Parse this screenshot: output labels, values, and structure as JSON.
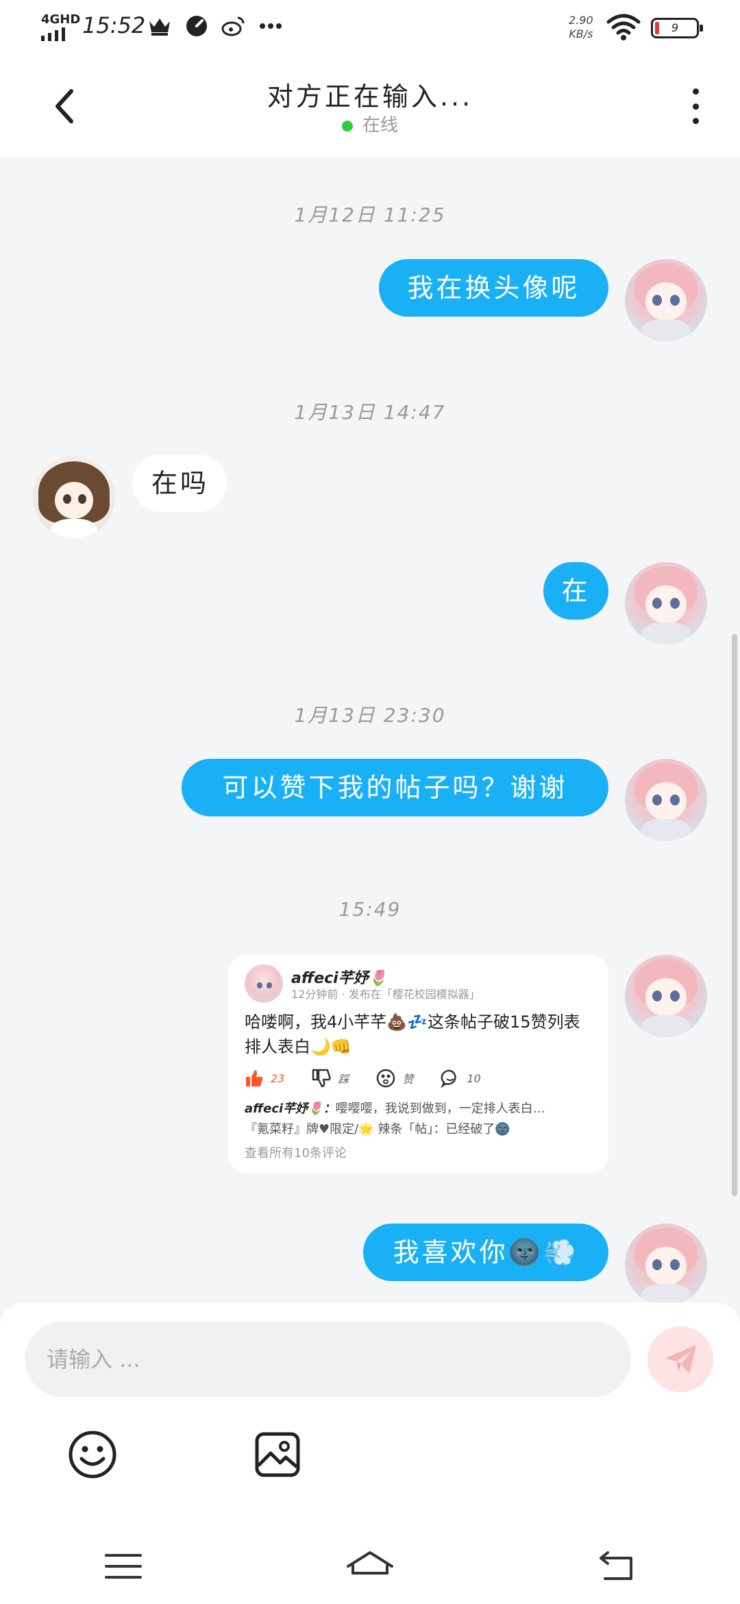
{
  "status_bar": {
    "network": "4GHD",
    "time": "15:52",
    "speed_value": "2.90",
    "speed_unit": "KB/s",
    "battery": "9",
    "icons": [
      "crown-icon",
      "speedometer-icon",
      "weibo-icon",
      "more-dots-icon",
      "wifi-icon",
      "battery-icon"
    ]
  },
  "header": {
    "title": "对方正在输入...",
    "presence": "在线",
    "icons": [
      "back-arrow-icon",
      "more-vertical-icon"
    ]
  },
  "chat": {
    "timestamps": [
      "1月12日 11:25",
      "1月13日 14:47",
      "1月13日 23:30",
      "15:49"
    ],
    "messages": [
      {
        "from": "me",
        "text": "我在换头像呢"
      },
      {
        "from": "her",
        "text": "在吗"
      },
      {
        "from": "me",
        "text": "在"
      },
      {
        "from": "me",
        "text": "可以赞下我的帖子吗？谢谢"
      },
      {
        "from": "me",
        "type": "post-card"
      },
      {
        "from": "me",
        "text": "我喜欢你🌚💨"
      }
    ]
  },
  "post_card": {
    "author": "affeci芊妤🌷",
    "meta": "12分钟前 · 发布在「樱花校园模拟器」",
    "text": "哈喽啊，我4小芊芊💩💤这条帖子破15赞列表排人表白🌙👊",
    "likes": "23",
    "dislike_label": "踩",
    "reaction_label": "赞",
    "comments": "10",
    "comment_author": "affeci芊妤🌷：",
    "comment_text": "嘤嘤嘤，我说到做到，一定排人表白…",
    "comment_line2": "『氪菜籽』牌♥限定/🌟 辣条「帖」：已经破了🌚",
    "view_all": "查看所有10条评论"
  },
  "composer": {
    "placeholder": "请输入 ...",
    "send_color": "#fde3e3",
    "tools": [
      "emoji-icon",
      "image-icon"
    ]
  },
  "nav_bar": {
    "icons": [
      "menu-icon",
      "home-icon",
      "back-icon"
    ]
  },
  "colors": {
    "accent": "#1ab0f5",
    "background": "#f4f5f7",
    "online": "#2ecc40"
  }
}
